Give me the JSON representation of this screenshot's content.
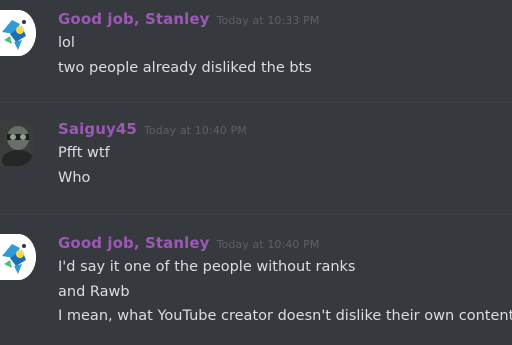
{
  "colors": {
    "background": "#36393e",
    "username_good_job": "#9b59b6",
    "username_saiguy": "#9b59b6",
    "timestamp": "#5d6067",
    "message_text": "#dcddde"
  },
  "messages": [
    {
      "username": "Good job, Stanley",
      "timestamp": "Today at 10:33 PM",
      "avatar_icon": "blue-mascot-avatar",
      "lines": [
        "lol",
        "two people already disliked the bts"
      ]
    },
    {
      "username": "Saiguy45",
      "timestamp": "Today at 10:40 PM",
      "avatar_icon": "photo-avatar",
      "lines": [
        "Pfft wtf",
        "Who"
      ]
    },
    {
      "username": "Good job, Stanley",
      "timestamp": "Today at 10:40 PM",
      "avatar_icon": "blue-mascot-avatar",
      "lines": [
        "I'd say it one of the people without ranks",
        "and Rawb",
        "I mean, what YouTube creator doesn't dislike their own content?"
      ]
    }
  ]
}
